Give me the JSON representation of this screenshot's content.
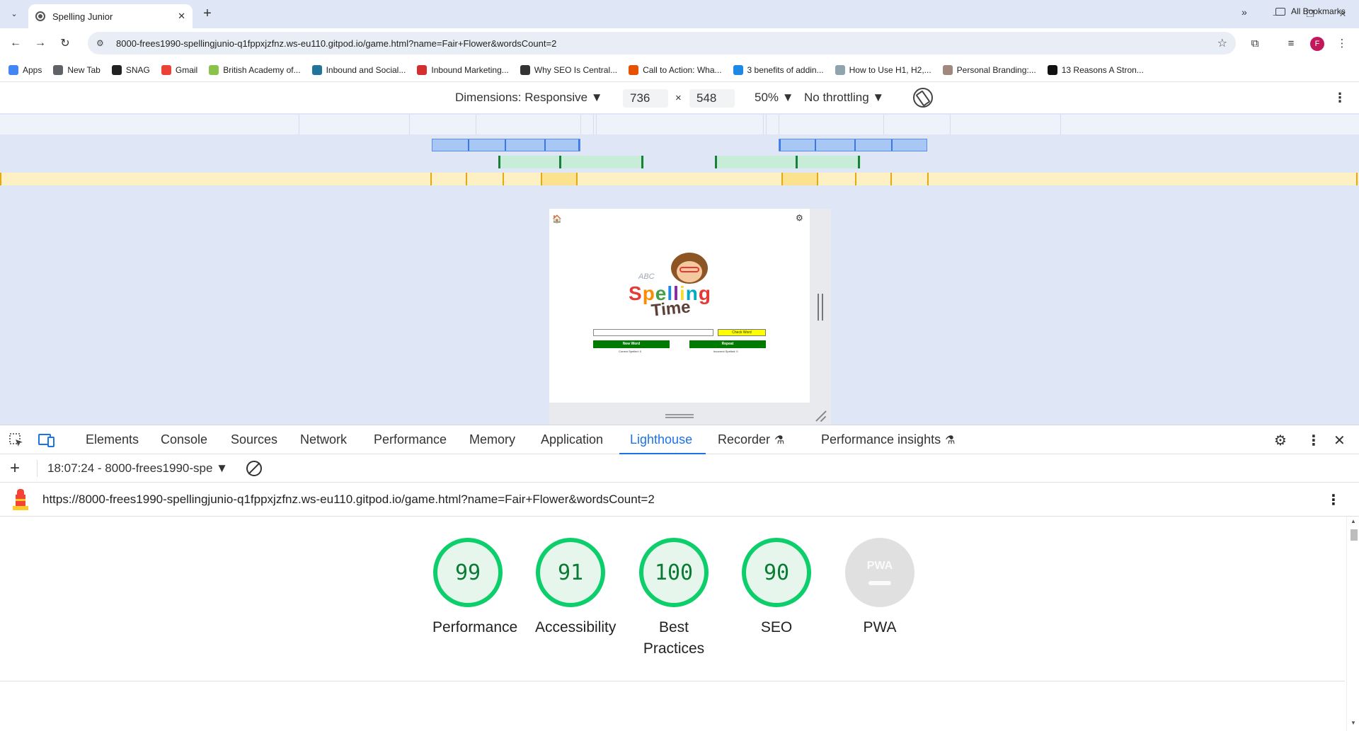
{
  "browser": {
    "tab_title": "Spelling Junior",
    "url": "8000-frees1990-spellingjunio-q1fppxjzfnz.ws-eu110.gitpod.io/game.html?name=Fair+Flower&wordsCount=2",
    "profile_initial": "F"
  },
  "bookmarks": {
    "items": [
      {
        "label": "Apps",
        "color": "#4285f4"
      },
      {
        "label": "New Tab",
        "color": "#5f6368"
      },
      {
        "label": "SNAG",
        "color": "#222222"
      },
      {
        "label": "Gmail",
        "color": "#ea4335"
      },
      {
        "label": "British Academy of...",
        "color": "#8bc34a"
      },
      {
        "label": "Inbound and Social...",
        "color": "#21759b"
      },
      {
        "label": "Inbound Marketing...",
        "color": "#d32f2f"
      },
      {
        "label": "Why SEO Is Central...",
        "color": "#333333"
      },
      {
        "label": "Call to Action: Wha...",
        "color": "#e65100"
      },
      {
        "label": "3 benefits of addin...",
        "color": "#1e88e5"
      },
      {
        "label": "How to Use H1, H2,...",
        "color": "#90a4ae"
      },
      {
        "label": "Personal Branding:...",
        "color": "#a1887f"
      },
      {
        "label": "13 Reasons A Stron...",
        "color": "#111111"
      }
    ],
    "more": "»",
    "all_bookmarks": "All Bookmarks"
  },
  "device_toolbar": {
    "dimensions_label": "Dimensions: Responsive ▼",
    "width": "736",
    "times": "×",
    "height": "548",
    "zoom": "50% ▼",
    "throttling": "No throttling ▼"
  },
  "app": {
    "logo_abc": "ABC",
    "logo_letters": [
      "S",
      "p",
      "e",
      "l",
      "l",
      "i",
      "n",
      "g"
    ],
    "logo_time": "Time",
    "check_button": "Check Word",
    "new_word_button": "New Word",
    "repeat_button": "Repeat",
    "correct_text": "Correct Spelled: 0",
    "incorrect_text": "Incorrect Spelled: 0"
  },
  "devtools": {
    "tabs": [
      "Elements",
      "Console",
      "Sources",
      "Network",
      "Performance",
      "Memory",
      "Application",
      "Lighthouse",
      "Recorder",
      "Performance insights"
    ],
    "active_tab": "Lighthouse",
    "report_selector": "18:07:24 - 8000-frees1990-spe ▼",
    "report_url": "https://8000-frees1990-spellingjunio-q1fppxjzfnz.ws-eu110.gitpod.io/game.html?name=Fair+Flower&wordsCount=2"
  },
  "lighthouse": {
    "scores": [
      {
        "label": "Performance",
        "value": "99"
      },
      {
        "label": "Accessibility",
        "value": "91"
      },
      {
        "label": "Best Practices",
        "value": "100"
      },
      {
        "label": "SEO",
        "value": "90"
      }
    ],
    "pwa": {
      "label": "PWA",
      "badge": "PWA"
    },
    "pass_color": "#0cce6b"
  }
}
